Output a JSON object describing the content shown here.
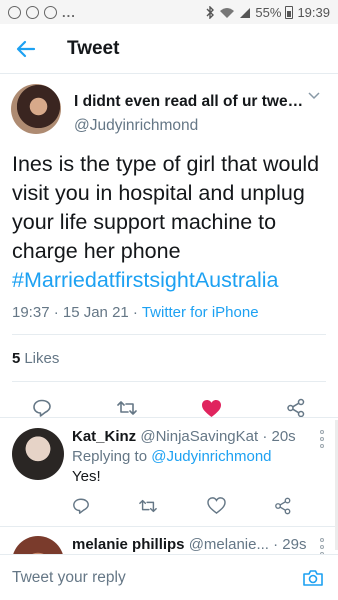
{
  "status_bar": {
    "dots": "...",
    "battery": "55%",
    "time": "19:39"
  },
  "header": {
    "title": "Tweet"
  },
  "tweet": {
    "display_name": "I didnt even read all of ur tweet ...",
    "handle": "@Judyinrichmond",
    "text": "Ines is the type of girl that would visit you in hospital and unplug your life support machine to charge her phone",
    "hashtag": "#MarriedatfirstsightAustralia",
    "timestamp": "19:37 · 15 Jan 21 · ",
    "source": "Twitter for iPhone",
    "likes_count": "5",
    "likes_label": "Likes",
    "liked": true
  },
  "replies": [
    {
      "name": "Kat_Kinz",
      "handle": "@NinjaSavingKat",
      "time": " · 20s",
      "replying_label": "Replying to ",
      "replying_to": "@Judyinrichmond",
      "text": "Yes!"
    },
    {
      "name": "melanie phillips",
      "handle": "@melanie...",
      "time": " · 29s"
    }
  ],
  "composer": {
    "placeholder": "Tweet your reply"
  },
  "colors": {
    "accent": "#1da1f2",
    "like": "#e0245e",
    "secondary_text": "#657786",
    "divider": "#e6ecf0"
  },
  "icons": [
    "back-arrow-icon",
    "chevron-down-icon",
    "reply-icon",
    "retweet-icon",
    "heart-icon",
    "share-icon",
    "camera-icon",
    "more-icon"
  ]
}
